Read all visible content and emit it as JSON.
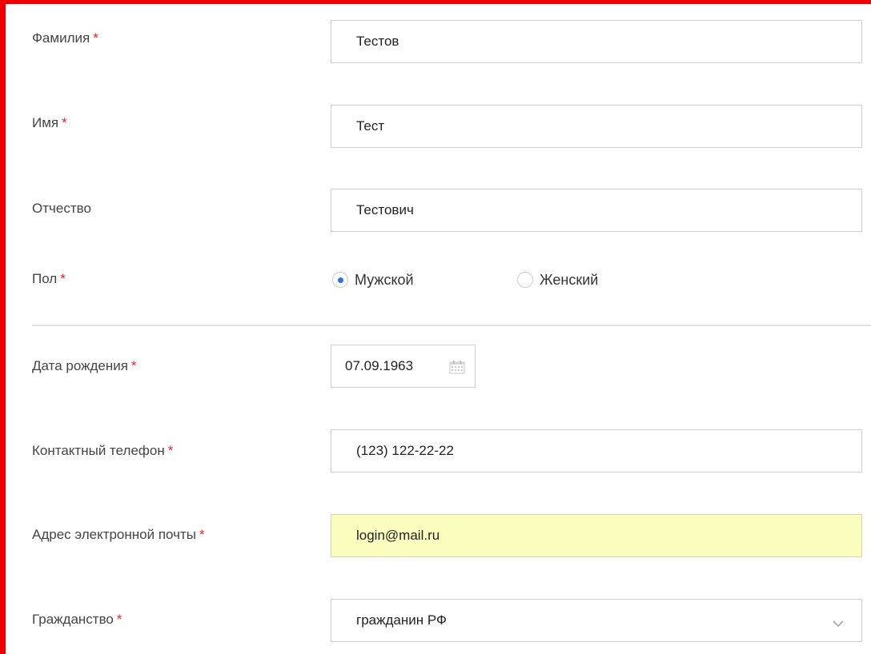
{
  "form": {
    "last_name": {
      "label": "Фамилия",
      "required_mark": "*",
      "value": "Тестов"
    },
    "first_name": {
      "label": "Имя",
      "required_mark": "*",
      "value": "Тест"
    },
    "patronymic": {
      "label": "Отчество",
      "value": "Тестович"
    },
    "gender": {
      "label": "Пол",
      "required_mark": "*",
      "options": [
        {
          "label": "Мужской",
          "checked": true
        },
        {
          "label": "Женский",
          "checked": false
        }
      ]
    },
    "birth_date": {
      "label": "Дата рождения",
      "required_mark": "*",
      "value": "07.09.1963",
      "icon": "calendar-icon"
    },
    "phone": {
      "label": "Контактный телефон",
      "required_mark": "*",
      "value": "(123) 122-22-22"
    },
    "email": {
      "label": "Адрес электронной почты",
      "required_mark": "*",
      "value": "login@mail.ru",
      "highlight_color": "#fbfdbe"
    },
    "citizenship": {
      "label": "Гражданство",
      "required_mark": "*",
      "value": "гражданин РФ",
      "icon": "chevron-down-icon"
    }
  },
  "colors": {
    "frame": "#ee0000",
    "required": "#e3262c",
    "radio_selected": "#2f72d6"
  }
}
